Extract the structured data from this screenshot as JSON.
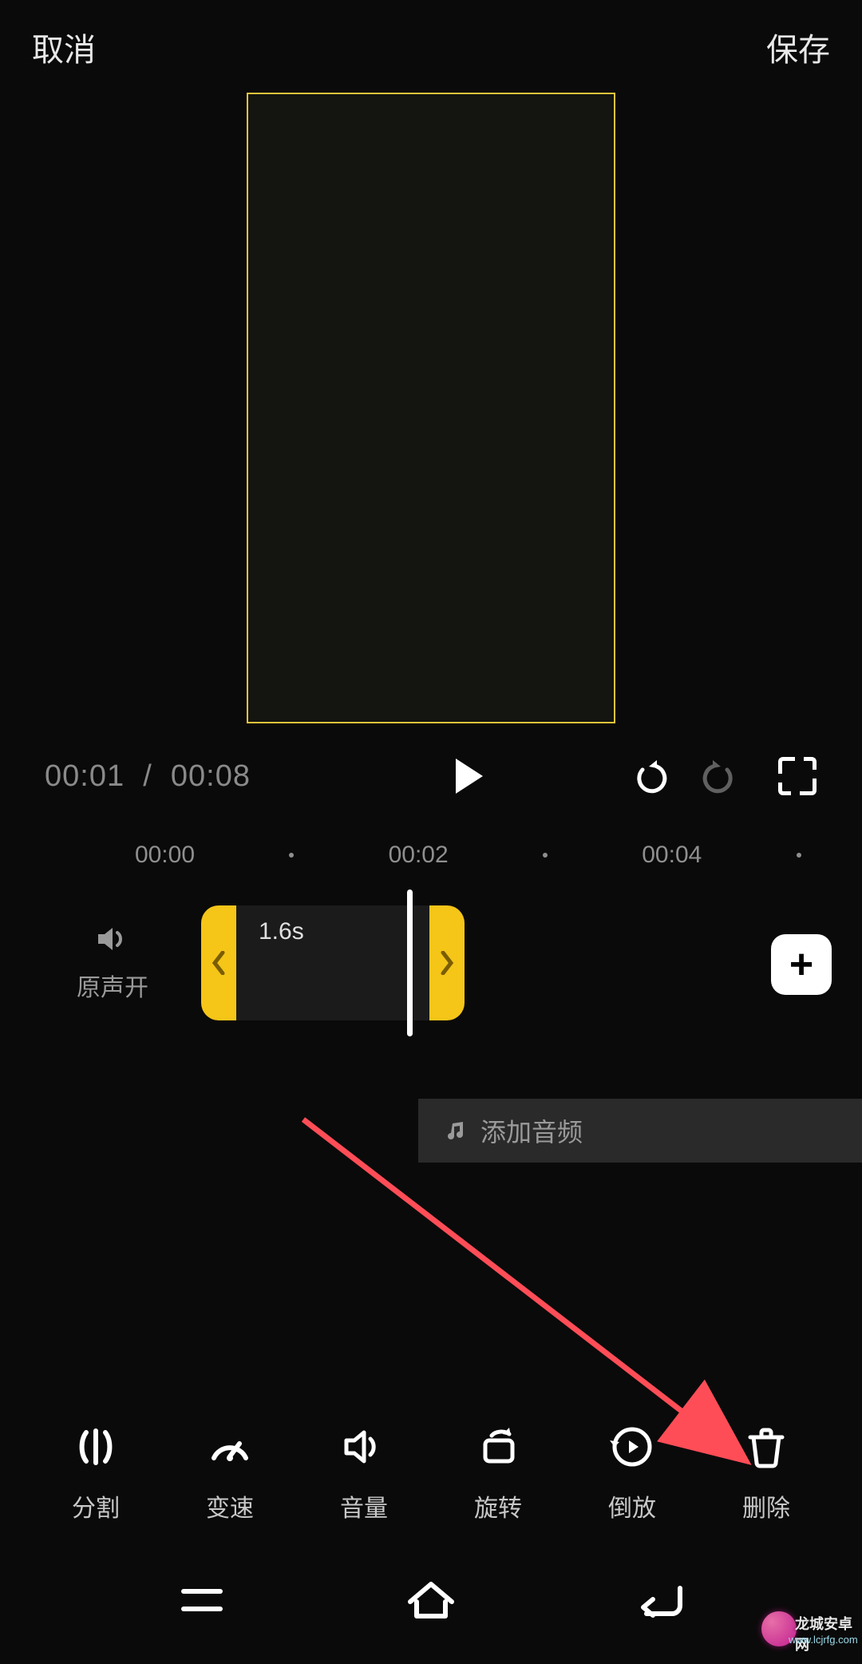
{
  "header": {
    "cancel": "取消",
    "save": "保存"
  },
  "playback": {
    "current": "00:01",
    "sep": "/",
    "total": "00:08"
  },
  "ruler": [
    "00:00",
    "00:02",
    "00:04"
  ],
  "sound": {
    "label": "原声开"
  },
  "clip": {
    "duration": "1.6s"
  },
  "audio": {
    "add_label": "添加音频"
  },
  "tools": [
    {
      "key": "split",
      "label": "分割"
    },
    {
      "key": "speed",
      "label": "变速"
    },
    {
      "key": "volume",
      "label": "音量"
    },
    {
      "key": "rotate",
      "label": "旋转"
    },
    {
      "key": "reverse",
      "label": "倒放"
    },
    {
      "key": "delete",
      "label": "删除"
    }
  ],
  "watermark": {
    "line1": "龙城安卓网",
    "line2": "www.lcjrfg.com"
  }
}
